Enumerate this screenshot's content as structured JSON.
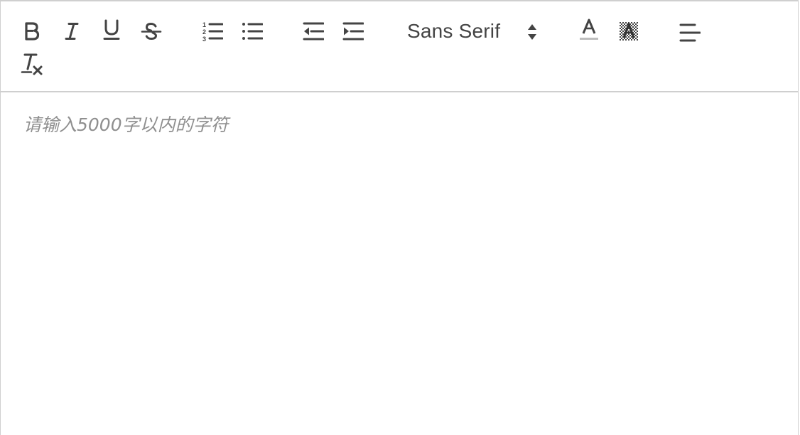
{
  "toolbar": {
    "buttons": [
      {
        "name": "bold",
        "icon": "bold-icon"
      },
      {
        "name": "italic",
        "icon": "italic-icon"
      },
      {
        "name": "underline",
        "icon": "underline-icon"
      },
      {
        "name": "strikethrough",
        "icon": "strikethrough-icon"
      },
      {
        "name": "ordered-list",
        "icon": "ordered-list-icon"
      },
      {
        "name": "bullet-list",
        "icon": "bullet-list-icon"
      },
      {
        "name": "outdent",
        "icon": "outdent-icon"
      },
      {
        "name": "indent",
        "icon": "indent-icon"
      },
      {
        "name": "text-color",
        "icon": "text-color-icon"
      },
      {
        "name": "background-color",
        "icon": "background-color-icon"
      },
      {
        "name": "align",
        "icon": "align-left-icon"
      },
      {
        "name": "clear-formatting",
        "icon": "clear-formatting-icon"
      }
    ],
    "font": {
      "selected": "Sans Serif"
    },
    "colors": {
      "icon": "#444444",
      "text_color_underline": "#bdbdbd"
    }
  },
  "editor": {
    "placeholder": "请输入5000字以内的字符",
    "placeholder_color": "#8f8f8f",
    "border_color": "#cfcfcf"
  }
}
